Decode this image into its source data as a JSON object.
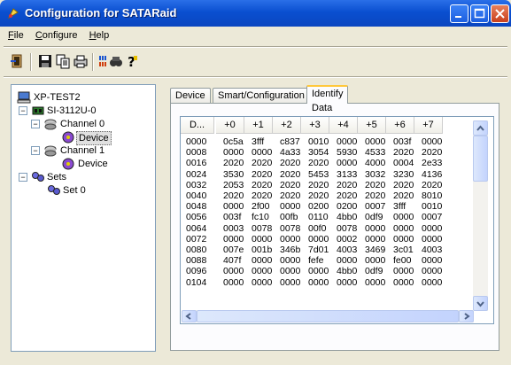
{
  "window": {
    "title": "Configuration for SATARaid",
    "accent": "#0b4fd0"
  },
  "menu": [
    {
      "label": "File",
      "ul": "F",
      "rest": "ile"
    },
    {
      "label": "Configure",
      "ul": "C",
      "rest": "onfigure"
    },
    {
      "label": "Help",
      "ul": "H",
      "rest": "elp"
    }
  ],
  "toolbar": {
    "icons": [
      "exit-icon",
      "save-icon",
      "copy-icon",
      "print-icon",
      "scan-icon",
      "search-icon",
      "help-icon"
    ]
  },
  "tree": {
    "root": "XP-TEST2",
    "controller": "SI-3112U-0",
    "channel0": "Channel 0",
    "device0": "Device",
    "channel1": "Channel 1",
    "device1": "Device",
    "sets": "Sets",
    "set0": "Set 0"
  },
  "tabs": [
    "Device",
    "Smart/Configuration",
    "Identify Data"
  ],
  "grid": {
    "headers": [
      "D...",
      "+0",
      "+1",
      "+2",
      "+3",
      "+4",
      "+5",
      "+6",
      "+7"
    ],
    "rows": [
      [
        "0000",
        "0c5a",
        "3fff",
        "c837",
        "0010",
        "0000",
        "0000",
        "003f",
        "0000"
      ],
      [
        "0008",
        "0000",
        "0000",
        "4a33",
        "3054",
        "5930",
        "4533",
        "2020",
        "2020"
      ],
      [
        "0016",
        "2020",
        "2020",
        "2020",
        "2020",
        "0000",
        "4000",
        "0004",
        "2e33"
      ],
      [
        "0024",
        "3530",
        "2020",
        "2020",
        "5453",
        "3133",
        "3032",
        "3230",
        "4136"
      ],
      [
        "0032",
        "2053",
        "2020",
        "2020",
        "2020",
        "2020",
        "2020",
        "2020",
        "2020"
      ],
      [
        "0040",
        "2020",
        "2020",
        "2020",
        "2020",
        "2020",
        "2020",
        "2020",
        "8010"
      ],
      [
        "0048",
        "0000",
        "2f00",
        "0000",
        "0200",
        "0200",
        "0007",
        "3fff",
        "0010"
      ],
      [
        "0056",
        "003f",
        "fc10",
        "00fb",
        "0110",
        "4bb0",
        "0df9",
        "0000",
        "0007"
      ],
      [
        "0064",
        "0003",
        "0078",
        "0078",
        "00f0",
        "0078",
        "0000",
        "0000",
        "0000"
      ],
      [
        "0072",
        "0000",
        "0000",
        "0000",
        "0000",
        "0002",
        "0000",
        "0000",
        "0000"
      ],
      [
        "0080",
        "007e",
        "001b",
        "346b",
        "7d01",
        "4003",
        "3469",
        "3c01",
        "4003"
      ],
      [
        "0088",
        "407f",
        "0000",
        "0000",
        "fefe",
        "0000",
        "0000",
        "fe00",
        "0000"
      ],
      [
        "0096",
        "0000",
        "0000",
        "0000",
        "0000",
        "4bb0",
        "0df9",
        "0000",
        "0000"
      ],
      [
        "0104",
        "0000",
        "0000",
        "0000",
        "0000",
        "0000",
        "0000",
        "0000",
        "0000"
      ]
    ]
  }
}
